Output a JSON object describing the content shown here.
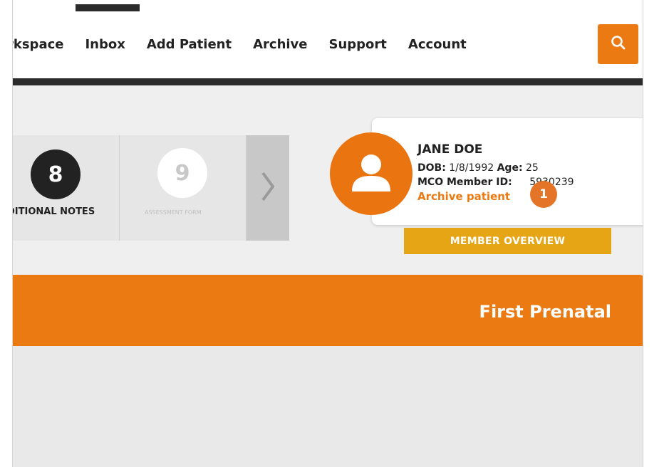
{
  "nav": {
    "items": [
      {
        "label": "rkspace"
      },
      {
        "label": "Inbox"
      },
      {
        "label": "Add Patient"
      },
      {
        "label": "Archive"
      },
      {
        "label": "Support"
      },
      {
        "label": "Account"
      }
    ],
    "search_icon": "search-icon"
  },
  "tiles": [
    {
      "number": "8",
      "label": "DITIONAL NOTES"
    },
    {
      "number": "9",
      "label": "ASSESSMENT FORM"
    }
  ],
  "tile_arrow": "›",
  "patient": {
    "name": "JANE DOE",
    "dob_label": "DOB:",
    "dob_value": "1/8/1992",
    "age_label": "Age:",
    "age_value": "25",
    "mco_label": "MCO Member ID:",
    "mco_value": "5930239",
    "archive_link": "Archive patient",
    "avatar_icon": "user-icon"
  },
  "callout": "1",
  "member_overview": "MEMBER OVERVIEW",
  "section": {
    "title": "First Prenatal"
  },
  "colors": {
    "accent_orange": "#ec7a12",
    "button_gold": "#e6a514",
    "dark_bar": "#2b2b2b"
  }
}
